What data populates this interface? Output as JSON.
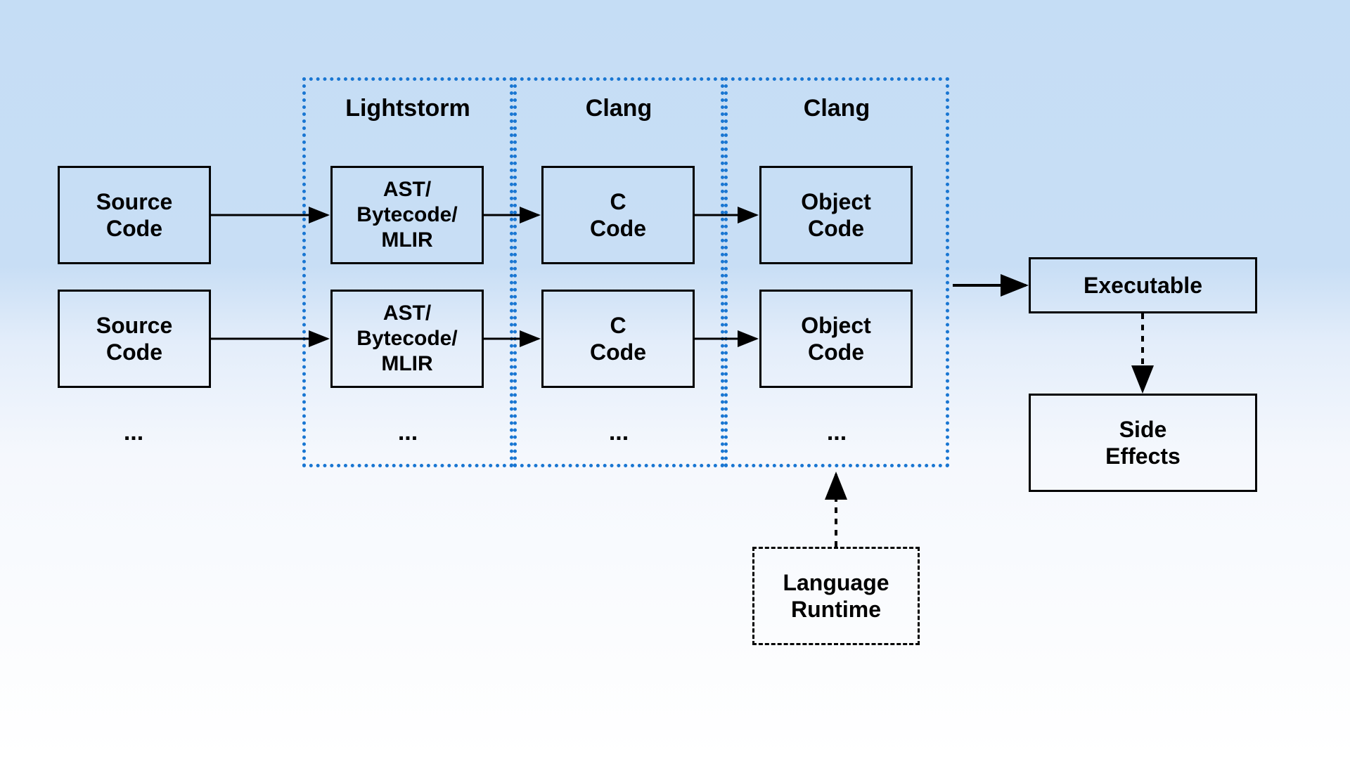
{
  "sources": {
    "row1": "Source\nCode",
    "row2": "Source\nCode",
    "ellipsis": "..."
  },
  "stages": {
    "lightstorm": {
      "label": "Lightstorm",
      "row1": "AST/\nBytecode/\nMLIR",
      "row2": "AST/\nBytecode/\nMLIR",
      "ellipsis": "..."
    },
    "clang1": {
      "label": "Clang",
      "row1": "C\nCode",
      "row2": "C\nCode",
      "ellipsis": "..."
    },
    "clang2": {
      "label": "Clang",
      "row1": "Object\nCode",
      "row2": "Object\nCode",
      "ellipsis": "..."
    }
  },
  "runtime": "Language\nRuntime",
  "executable": "Executable",
  "sideEffects": "Side\nEffects"
}
